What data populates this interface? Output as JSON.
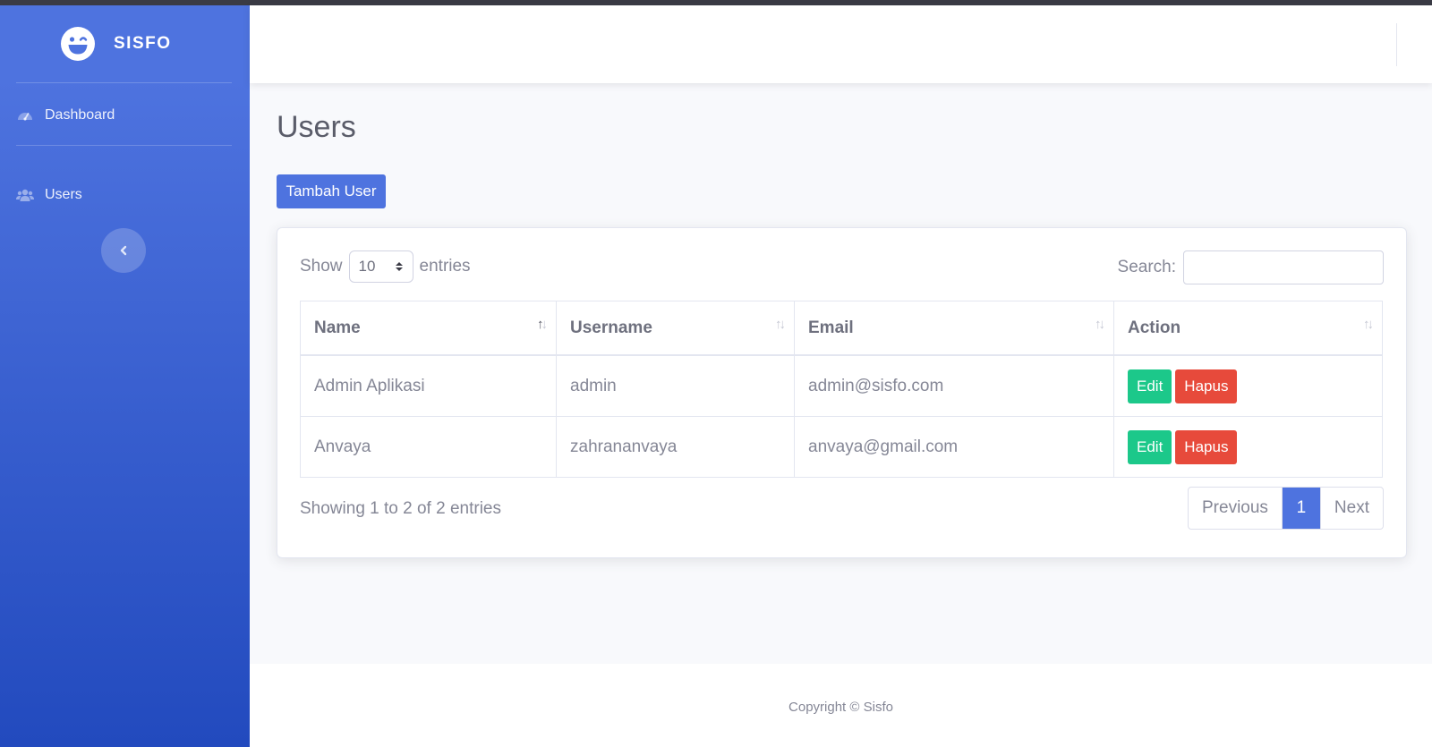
{
  "brand": {
    "name": "SISFO",
    "icon": "laugh-wink-icon"
  },
  "sidebar": {
    "items": [
      {
        "label": "Dashboard",
        "icon": "tachometer-icon"
      },
      {
        "label": "Users",
        "icon": "users-icon"
      }
    ],
    "toggle_icon": "chevron-left-icon"
  },
  "page": {
    "title": "Users",
    "add_button": "Tambah User"
  },
  "datatable": {
    "length": {
      "prefix": "Show",
      "value": "10",
      "suffix": "entries"
    },
    "search": {
      "label": "Search:",
      "value": ""
    },
    "columns": [
      "Name",
      "Username",
      "Email",
      "Action"
    ],
    "rows": [
      {
        "name": "Admin Aplikasi",
        "username": "admin",
        "email": "admin@sisfo.com",
        "edit": "Edit",
        "delete": "Hapus"
      },
      {
        "name": "Anvaya",
        "username": "zahrananvaya",
        "email": "anvaya@gmail.com",
        "edit": "Edit",
        "delete": "Hapus"
      }
    ],
    "info": "Showing 1 to 2 of 2 entries",
    "pagination": {
      "previous": "Previous",
      "current": "1",
      "next": "Next"
    }
  },
  "footer": {
    "copyright": "Copyright © Sisfo"
  },
  "colors": {
    "primary": "#4e73df",
    "success": "#1cc88a",
    "danger": "#e74a3b",
    "sidebar_gradient_end": "#224abe"
  }
}
